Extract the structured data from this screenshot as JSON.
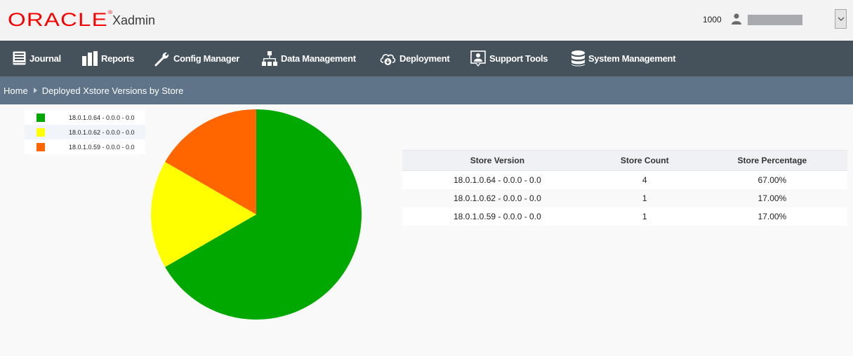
{
  "header": {
    "brand": "ORACLE",
    "app_name": "Xadmin",
    "org_id": "1000",
    "username_redacted": true
  },
  "nav": {
    "items": [
      {
        "label": "Journal",
        "icon": "journal-book-icon"
      },
      {
        "label": "Reports",
        "icon": "reports-bar-icon"
      },
      {
        "label": "Config Manager",
        "icon": "wrench-icon"
      },
      {
        "label": "Data Management",
        "icon": "hierarchy-icon"
      },
      {
        "label": "Deployment",
        "icon": "cloud-download-icon"
      },
      {
        "label": "Support Tools",
        "icon": "support-person-icon"
      },
      {
        "label": "System Management",
        "icon": "database-icon"
      }
    ]
  },
  "breadcrumb": {
    "home": "Home",
    "current": "Deployed Xstore Versions by Store"
  },
  "table": {
    "headers": [
      "Store Version",
      "Store Count",
      "Store Percentage"
    ],
    "rows": [
      [
        "18.0.1.0.64 - 0.0.0 - 0.0",
        "4",
        "67.00%"
      ],
      [
        "18.0.1.0.62 - 0.0.0 - 0.0",
        "1",
        "17.00%"
      ],
      [
        "18.0.1.0.59 - 0.0.0 - 0.0",
        "1",
        "17.00%"
      ]
    ]
  },
  "chart_data": {
    "type": "pie",
    "title": "",
    "legend_position": "top-left",
    "categories": [
      "18.0.1.0.64 - 0.0.0 - 0.0",
      "18.0.1.0.62 - 0.0.0 - 0.0",
      "18.0.1.0.59 - 0.0.0 - 0.0"
    ],
    "values": [
      4,
      1,
      1
    ],
    "percentages": [
      67.0,
      17.0,
      17.0
    ],
    "colors": [
      "#00a800",
      "#ffff00",
      "#ff6600"
    ],
    "start_angle_deg": 0,
    "direction": "clockwise"
  }
}
